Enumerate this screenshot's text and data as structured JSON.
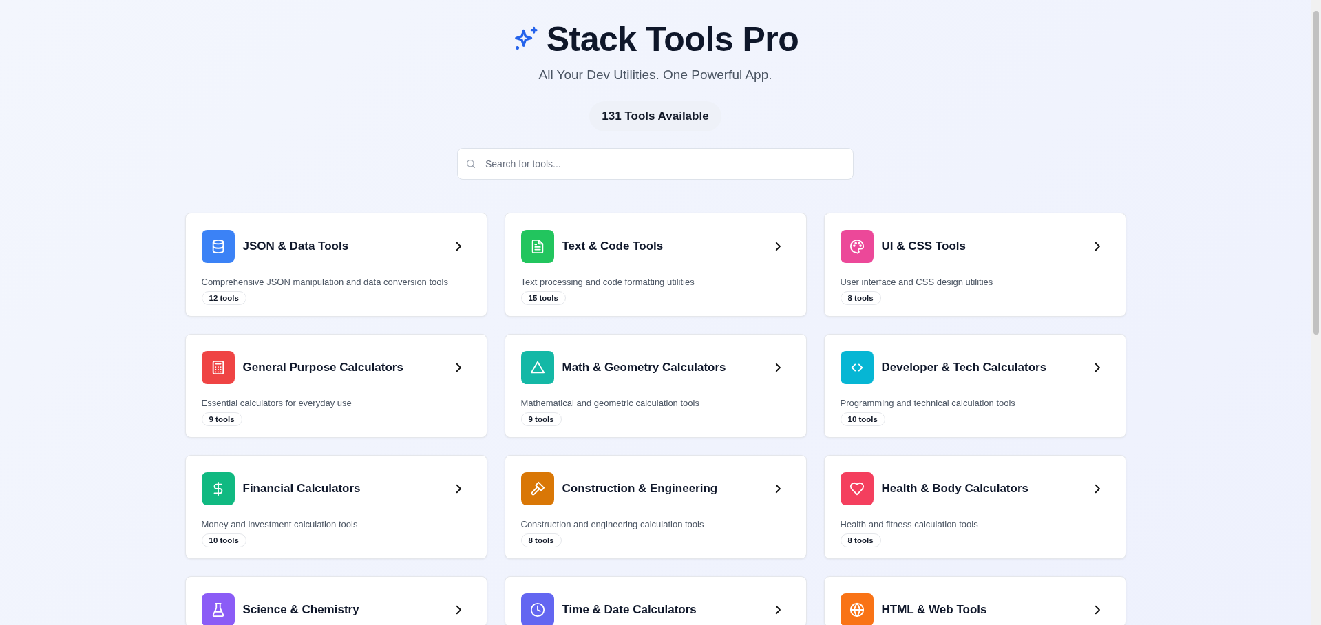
{
  "header": {
    "title": "Stack Tools Pro",
    "subtitle": "All Your Dev Utilities. One Powerful App.",
    "count_badge": "131 Tools Available"
  },
  "search": {
    "placeholder": "Search for tools..."
  },
  "categories": [
    {
      "kind": "database",
      "color": "#3b82f6",
      "title": "JSON & Data Tools",
      "description": "Comprehensive JSON manipulation and data conversion tools",
      "count": "12 tools"
    },
    {
      "kind": "document",
      "color": "#22c55e",
      "title": "Text & Code Tools",
      "description": "Text processing and code formatting utilities",
      "count": "15 tools"
    },
    {
      "kind": "palette",
      "color": "#ec4899",
      "title": "UI & CSS Tools",
      "description": "User interface and CSS design utilities",
      "count": "8 tools"
    },
    {
      "kind": "calculator",
      "color": "#ef4444",
      "title": "General Purpose Calculators",
      "description": "Essential calculators for everyday use",
      "count": "9 tools"
    },
    {
      "kind": "triangle",
      "color": "#14b8a6",
      "title": "Math & Geometry Calculators",
      "description": "Mathematical and geometric calculation tools",
      "count": "9 tools"
    },
    {
      "kind": "code",
      "color": "#06b6d4",
      "title": "Developer & Tech Calculators",
      "description": "Programming and technical calculation tools",
      "count": "10 tools"
    },
    {
      "kind": "dollar",
      "color": "#10b981",
      "title": "Financial Calculators",
      "description": "Money and investment calculation tools",
      "count": "10 tools"
    },
    {
      "kind": "hammer",
      "color": "#d97706",
      "title": "Construction & Engineering",
      "description": "Construction and engineering calculation tools",
      "count": "8 tools"
    },
    {
      "kind": "heart",
      "color": "#f43f5e",
      "title": "Health & Body Calculators",
      "description": "Health and fitness calculation tools",
      "count": "8 tools"
    },
    {
      "kind": "flask",
      "color": "#8b5cf6",
      "title": "Science & Chemistry"
    },
    {
      "kind": "clock",
      "color": "#6366f1",
      "title": "Time & Date Calculators"
    },
    {
      "kind": "globe",
      "color": "#f97316",
      "title": "HTML & Web Tools"
    }
  ]
}
